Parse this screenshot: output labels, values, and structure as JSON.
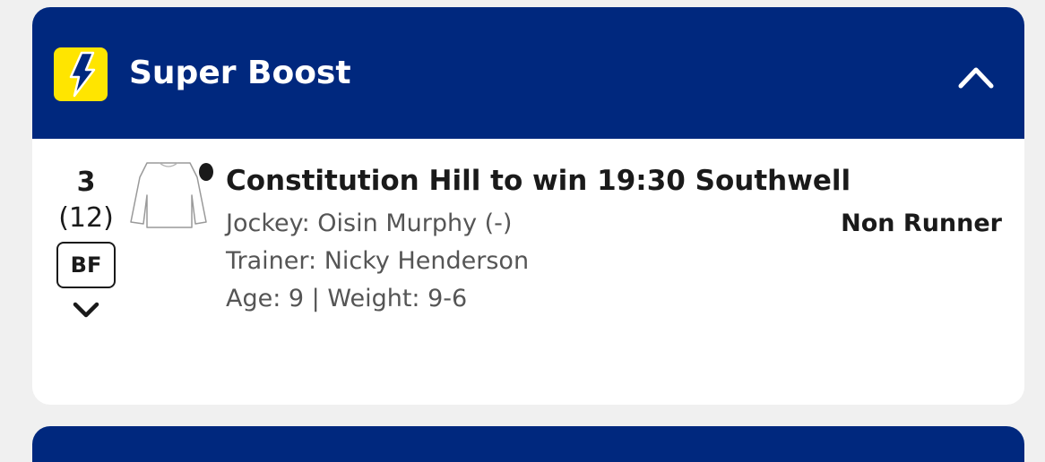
{
  "header": {
    "title": "Super Boost",
    "icon": "lightning-bolt-icon",
    "collapse_icon": "chevron-up-icon",
    "background_color": "#00287e",
    "icon_color": "#ffe500"
  },
  "selection": {
    "number": "3",
    "draw": "(12)",
    "badge": "BF",
    "expand_icon": "chevron-down-icon",
    "silk_icon": "jockey-silk-icon",
    "title": "Constitution Hill to win 19:30 Southwell",
    "jockey": "Jockey: Oisin Murphy (-)",
    "trainer": "Trainer: Nicky Henderson",
    "age_weight": "Age: 9 | Weight: 9-6",
    "status": "Non Runner"
  }
}
